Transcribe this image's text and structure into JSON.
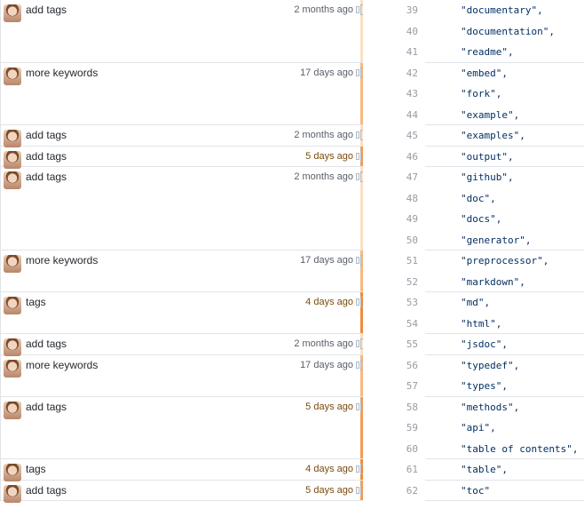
{
  "blame": {
    "hunks": [
      {
        "message": "add tags",
        "age": "2 months ago",
        "heat": "#fbe0c3",
        "age_color": "#586069",
        "icon": "reblame-icon",
        "lines": [
          {
            "num": "39",
            "text": "\"documentary\","
          },
          {
            "num": "40",
            "text": "\"documentation\","
          },
          {
            "num": "41",
            "text": "\"readme\","
          }
        ]
      },
      {
        "message": "more keywords",
        "age": "17 days ago",
        "heat": "#f9b880",
        "age_color": "#586069",
        "icon": "reblame-icon",
        "lines": [
          {
            "num": "42",
            "text": "\"embed\","
          },
          {
            "num": "43",
            "text": "\"fork\","
          },
          {
            "num": "44",
            "text": "\"example\","
          }
        ]
      },
      {
        "message": "add tags",
        "age": "2 months ago",
        "heat": "#fbe0c3",
        "age_color": "#586069",
        "icon": "reblame-icon",
        "lines": [
          {
            "num": "45",
            "text": "\"examples\","
          }
        ]
      },
      {
        "message": "add tags",
        "age": "5 days ago",
        "heat": "#f39c56",
        "age_color": "#7a4a0c",
        "icon": "reblame-icon",
        "lines": [
          {
            "num": "46",
            "text": "\"output\","
          }
        ]
      },
      {
        "message": "add tags",
        "age": "2 months ago",
        "heat": "#fbe0c3",
        "age_color": "#586069",
        "icon": "reblame-icon",
        "lines": [
          {
            "num": "47",
            "text": "\"github\","
          },
          {
            "num": "48",
            "text": "\"doc\","
          },
          {
            "num": "49",
            "text": "\"docs\","
          },
          {
            "num": "50",
            "text": "\"generator\","
          }
        ]
      },
      {
        "message": "more keywords",
        "age": "17 days ago",
        "heat": "#f9b880",
        "age_color": "#586069",
        "icon": "reblame-icon",
        "lines": [
          {
            "num": "51",
            "text": "\"preprocessor\","
          },
          {
            "num": "52",
            "text": "\"markdown\","
          }
        ]
      },
      {
        "message": "tags",
        "age": "4 days ago",
        "heat": "#f08b3a",
        "age_color": "#7a4a0c",
        "icon": "reblame-icon",
        "lines": [
          {
            "num": "53",
            "text": "\"md\","
          },
          {
            "num": "54",
            "text": "\"html\","
          }
        ]
      },
      {
        "message": "add tags",
        "age": "2 months ago",
        "heat": "#fbe0c3",
        "age_color": "#586069",
        "icon": "reblame-icon",
        "lines": [
          {
            "num": "55",
            "text": "\"jsdoc\","
          }
        ]
      },
      {
        "message": "more keywords",
        "age": "17 days ago",
        "heat": "#f9b880",
        "age_color": "#586069",
        "icon": "reblame-icon",
        "lines": [
          {
            "num": "56",
            "text": "\"typedef\","
          },
          {
            "num": "57",
            "text": "\"types\","
          }
        ]
      },
      {
        "message": "add tags",
        "age": "5 days ago",
        "heat": "#f39c56",
        "age_color": "#7a4a0c",
        "icon": "reblame-icon",
        "lines": [
          {
            "num": "58",
            "text": "\"methods\","
          },
          {
            "num": "59",
            "text": "\"api\","
          },
          {
            "num": "60",
            "text": "\"table of contents\","
          }
        ]
      },
      {
        "message": "tags",
        "age": "4 days ago",
        "heat": "#f08b3a",
        "age_color": "#7a4a0c",
        "icon": "reblame-icon",
        "lines": [
          {
            "num": "61",
            "text": "\"table\","
          }
        ]
      },
      {
        "message": "add tags",
        "age": "5 days ago",
        "heat": "#f39c56",
        "age_color": "#7a4a0c",
        "icon": "reblame-icon",
        "lines": [
          {
            "num": "62",
            "text": "\"toc\""
          }
        ]
      }
    ]
  }
}
